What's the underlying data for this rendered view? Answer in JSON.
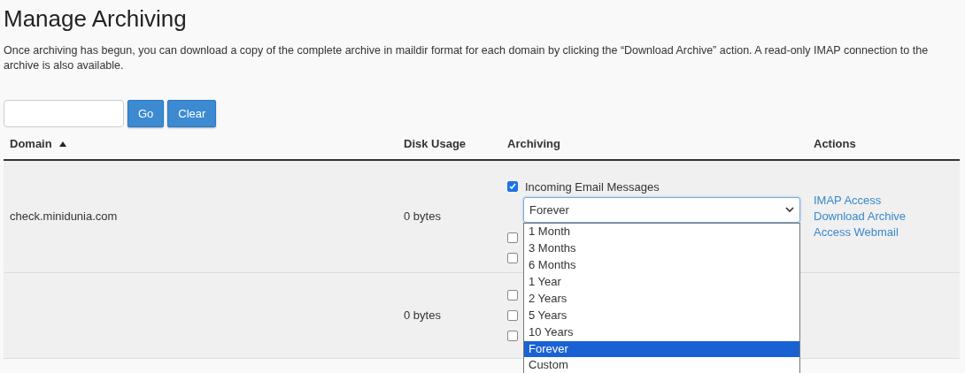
{
  "page": {
    "title": "Manage Archiving",
    "description": "Once archiving has begun, you can download a copy of the complete archive in maildir format for each domain by clicking the “Download Archive” action. A read-only IMAP connection to the archive is also available."
  },
  "buttons": [
    "Go",
    "Clear"
  ],
  "table": {
    "columns": [
      {
        "label": "Domain",
        "sorted": true
      },
      {
        "label": "Disk Usage"
      },
      {
        "label": "Archiving"
      },
      {
        "label": "Actions"
      }
    ],
    "rows": [
      {
        "domain": "check.minidunia.com",
        "disk_usage": "0 bytes",
        "archive_types": [
          {
            "checked": true,
            "label": "Incoming Email Messages",
            "retention": "Forever"
          },
          {
            "checked": false
          },
          {
            "checked": false
          }
        ],
        "actions": [
          "IMAP Access",
          "Download Archive",
          "Access Webmail"
        ]
      },
      {
        "disk_usage": "0 bytes",
        "archive_types": [
          {
            "checked": false
          },
          {
            "checked": false
          },
          {
            "checked": false
          }
        ],
        "actions": []
      }
    ]
  },
  "dropdown": {
    "options": [
      {
        "label": "1 Month",
        "selected": false
      },
      {
        "label": "3 Months",
        "selected": false
      },
      {
        "label": "6 Months",
        "selected": false
      },
      {
        "label": "1 Year",
        "selected": false
      },
      {
        "label": "2 Years",
        "selected": false
      },
      {
        "label": "5 Years",
        "selected": false
      },
      {
        "label": "10 Years",
        "selected": false
      },
      {
        "label": "Forever",
        "selected": true
      },
      {
        "label": "Custom",
        "selected": false
      }
    ]
  }
}
